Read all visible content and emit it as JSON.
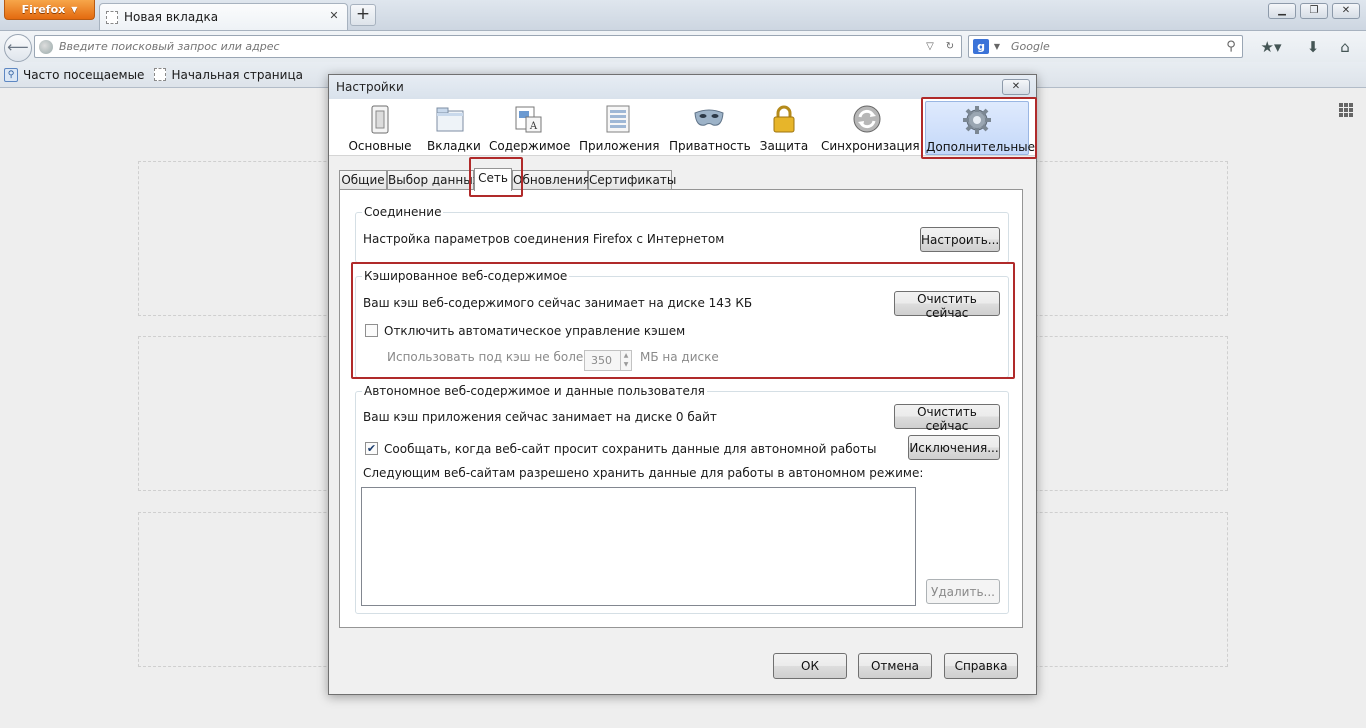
{
  "browser": {
    "app_button": "Firefox",
    "tab_title": "Новая вкладка",
    "url_placeholder": "Введите поисковый запрос или адрес",
    "search_placeholder": "Google",
    "bookmarks": [
      "Часто посещаемые",
      "Начальная страница"
    ]
  },
  "dialog": {
    "title": "Настройки",
    "panes": [
      {
        "label": "Основные"
      },
      {
        "label": "Вкладки"
      },
      {
        "label": "Содержимое"
      },
      {
        "label": "Приложения"
      },
      {
        "label": "Приватность"
      },
      {
        "label": "Защита"
      },
      {
        "label": "Синхронизация"
      },
      {
        "label": "Дополнительные"
      }
    ],
    "selected_pane": "Дополнительные",
    "subtabs": [
      "Общие",
      "Выбор данных",
      "Сеть",
      "Обновления",
      "Сертификаты"
    ],
    "selected_subtab": "Сеть",
    "connection": {
      "legend": "Соединение",
      "text": "Настройка параметров соединения Firefox с Интернетом",
      "button": "Настроить..."
    },
    "cache": {
      "legend": "Кэшированное веб-содержимое",
      "usage_text": "Ваш кэш веб-содержимого сейчас занимает на диске 143 КБ",
      "clear_button": "Очистить сейчас",
      "override_label": "Отключить автоматическое управление кэшем",
      "override_checked": false,
      "limit_prefix": "Использовать под кэш не более",
      "limit_value": "350",
      "limit_suffix": "МБ на диске"
    },
    "offline": {
      "legend": "Автономное веб-содержимое и данные пользователя",
      "usage_text": "Ваш кэш приложения сейчас занимает на диске 0 байт",
      "clear_button": "Очистить сейчас",
      "notify_label": "Сообщать, когда веб-сайт просит сохранить данные для автономной работы",
      "notify_checked": true,
      "exceptions_button": "Исключения...",
      "allowed_sites_label": "Следующим веб-сайтам разрешено хранить данные для работы в автономном режиме:",
      "remove_button": "Удалить..."
    },
    "buttons": {
      "ok": "ОК",
      "cancel": "Отмена",
      "help": "Справка"
    }
  }
}
